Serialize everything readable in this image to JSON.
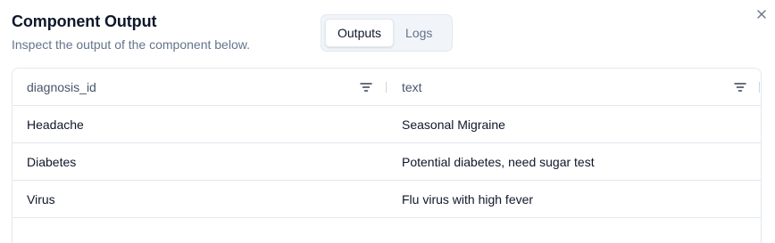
{
  "dialog": {
    "title": "Component Output",
    "subtitle": "Inspect the output of the component below.",
    "close_icon": "close-icon"
  },
  "tabs": [
    {
      "label": "Outputs",
      "active": true
    },
    {
      "label": "Logs",
      "active": false
    }
  ],
  "table": {
    "columns": [
      {
        "label": "diagnosis_id",
        "icon": "filter-icon"
      },
      {
        "label": "text",
        "icon": "filter-icon"
      }
    ],
    "rows": [
      {
        "diagnosis_id": "Headache",
        "text": "Seasonal Migraine"
      },
      {
        "diagnosis_id": "Diabetes",
        "text": "Potential diabetes, need sugar test"
      },
      {
        "diagnosis_id": "Virus",
        "text": "Flu virus with high fever"
      }
    ]
  },
  "colors": {
    "text": "#0f172a",
    "muted": "#64748b",
    "border": "#e2e8f0",
    "tab_bg": "#f1f5f9"
  }
}
